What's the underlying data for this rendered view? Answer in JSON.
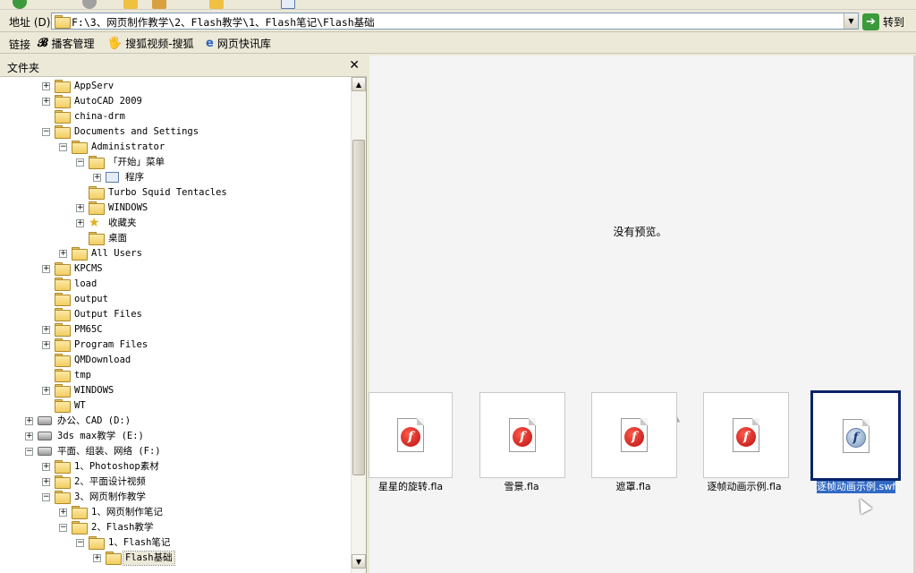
{
  "address": {
    "label": "地址 (D)",
    "path": "F:\\3、网页制作教学\\2、Flash教学\\1、Flash笔记\\Flash基础",
    "go_label": "转到"
  },
  "links": {
    "label": "链接",
    "items": [
      "播客管理",
      "搜狐视频-搜狐",
      "网页快讯库"
    ]
  },
  "folders": {
    "title": "文件夹",
    "close": "✕",
    "tree": [
      {
        "label": "AppServ",
        "expander": "+"
      },
      {
        "label": "AutoCAD 2009",
        "expander": "+"
      },
      {
        "label": "china-drm",
        "expander": ""
      },
      {
        "label": "Documents and Settings",
        "expander": "−"
      },
      {
        "label": "Administrator",
        "expander": "−"
      },
      {
        "label": "「开始」菜单",
        "expander": "−"
      },
      {
        "label": "程序",
        "expander": "+"
      },
      {
        "label": "Turbo Squid Tentacles",
        "expander": ""
      },
      {
        "label": "WINDOWS",
        "expander": "+"
      },
      {
        "label": "收藏夹",
        "expander": "+"
      },
      {
        "label": "桌面",
        "expander": ""
      },
      {
        "label": "All Users",
        "expander": "+"
      },
      {
        "label": "KPCMS",
        "expander": "+"
      },
      {
        "label": "load",
        "expander": ""
      },
      {
        "label": "output",
        "expander": ""
      },
      {
        "label": "Output Files",
        "expander": ""
      },
      {
        "label": "PM65C",
        "expander": "+"
      },
      {
        "label": "Program Files",
        "expander": "+"
      },
      {
        "label": "QMDownload",
        "expander": ""
      },
      {
        "label": "tmp",
        "expander": ""
      },
      {
        "label": "WINDOWS",
        "expander": "+"
      },
      {
        "label": "WT",
        "expander": ""
      },
      {
        "label": "办公、CAD (D:)",
        "expander": "+"
      },
      {
        "label": "3ds max教学 (E:)",
        "expander": "+"
      },
      {
        "label": "平面、组装、网络 (F:)",
        "expander": "−"
      },
      {
        "label": "1、Photoshop素材",
        "expander": "+"
      },
      {
        "label": "2、平面设计视频",
        "expander": "+"
      },
      {
        "label": "3、网页制作教学",
        "expander": "−"
      },
      {
        "label": "1、网页制作笔记",
        "expander": "+"
      },
      {
        "label": "2、Flash教学",
        "expander": "−"
      },
      {
        "label": "1、Flash笔记",
        "expander": "−"
      },
      {
        "label": "Flash基础",
        "expander": "+"
      }
    ]
  },
  "preview": {
    "message": "没有预览。",
    "files": [
      {
        "name": "星星的旋转.fla",
        "type": "fla"
      },
      {
        "name": "雪景.fla",
        "type": "fla"
      },
      {
        "name": "遮罩.fla",
        "type": "fla"
      },
      {
        "name": "逐帧动画示例.fla",
        "type": "fla"
      },
      {
        "name": "逐帧动画示例.swf",
        "type": "swf",
        "selected": true
      }
    ]
  }
}
